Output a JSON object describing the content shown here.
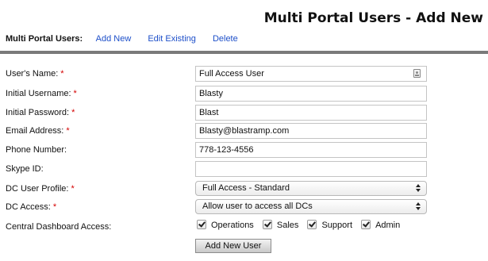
{
  "header": {
    "title": "Multi Portal Users - Add New"
  },
  "subnav": {
    "lead": "Multi Portal Users:",
    "links": [
      "Add New",
      "Edit Existing",
      "Delete"
    ]
  },
  "required_mark": "*",
  "form": {
    "users_name": {
      "label": "User's Name:",
      "value": "Full Access User",
      "required": true
    },
    "initial_username": {
      "label": "Initial Username:",
      "value": "Blasty",
      "required": true
    },
    "initial_password": {
      "label": "Initial Password:",
      "value": "Blast",
      "required": true
    },
    "email": {
      "label": "Email Address:",
      "value": "Blasty@blastramp.com",
      "required": true
    },
    "phone": {
      "label": "Phone Number:",
      "value": "778-123-4556",
      "required": false
    },
    "skype": {
      "label": "Skype ID:",
      "value": "",
      "required": false
    },
    "dc_user_profile": {
      "label": "DC User Profile:",
      "value": "Full Access - Standard",
      "required": true
    },
    "dc_access": {
      "label": "DC Access:",
      "value": "Allow user to access all DCs",
      "required": true
    },
    "central_dashboard": {
      "label": "Central Dashboard Access:",
      "options": [
        {
          "label": "Operations",
          "checked": true
        },
        {
          "label": "Sales",
          "checked": true
        },
        {
          "label": "Support",
          "checked": true
        },
        {
          "label": "Admin",
          "checked": true
        }
      ]
    },
    "submit_label": "Add New User"
  },
  "icons": {
    "contact_card": "contact-card-icon",
    "select_arrows": "updown-arrows-icon",
    "checkbox_check": "check-icon"
  },
  "colors": {
    "link": "#1d4fc9",
    "required": "#d40000",
    "rule": "#7a7a7a"
  }
}
